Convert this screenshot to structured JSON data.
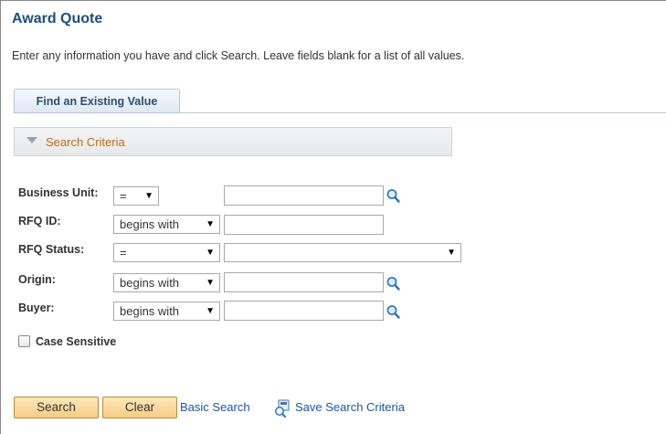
{
  "page": {
    "title": "Award Quote",
    "instructions": "Enter any information you have and click Search. Leave fields blank for a list of all values."
  },
  "tabs": [
    {
      "label": "Find an Existing Value",
      "active": true
    }
  ],
  "section": {
    "title": "Search Criteria",
    "icon": "triangle-down-icon"
  },
  "fields": {
    "business_unit": {
      "label": "Business Unit:",
      "operator": "=",
      "value": ""
    },
    "rfq_id": {
      "label": "RFQ ID:",
      "operator": "begins with",
      "value": ""
    },
    "rfq_status": {
      "label": "RFQ Status:",
      "operator": "=",
      "value": ""
    },
    "origin": {
      "label": "Origin:",
      "operator": "begins with",
      "value": ""
    },
    "buyer": {
      "label": "Buyer:",
      "operator": "begins with",
      "value": ""
    }
  },
  "case_sensitive": {
    "label": "Case Sensitive",
    "checked": false
  },
  "actions": {
    "search_label": "Search",
    "clear_label": "Clear",
    "basic_search_label": "Basic Search",
    "save_search_label": "Save Search Criteria"
  },
  "icons": {
    "lookup": "magnifier-icon",
    "save_search": "save-search-icon",
    "dropdown": "dropdown-arrow-icon"
  },
  "colors": {
    "title": "#1f4e79",
    "section_title": "#c76a12",
    "link": "#1c55a2",
    "button_bg": "#f7cd86"
  }
}
